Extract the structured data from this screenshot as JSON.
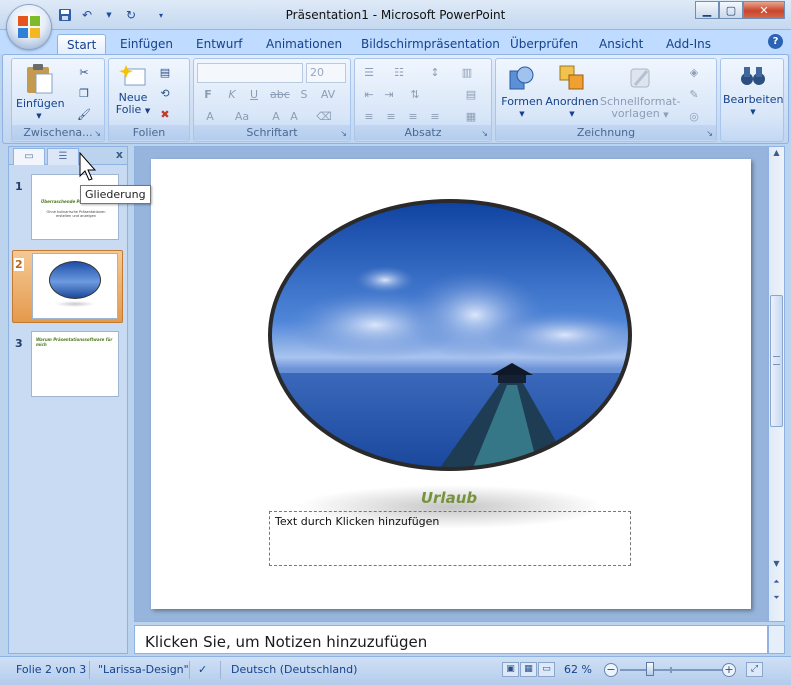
{
  "window": {
    "title": "Präsentation1 - Microsoft PowerPoint"
  },
  "tabs": [
    {
      "label": "Start",
      "active": true
    },
    {
      "label": "Einfügen"
    },
    {
      "label": "Entwurf"
    },
    {
      "label": "Animationen"
    },
    {
      "label": "Bildschirmpräsentation"
    },
    {
      "label": "Überprüfen"
    },
    {
      "label": "Ansicht"
    },
    {
      "label": "Add-Ins"
    }
  ],
  "ribbon": {
    "groups": {
      "clipboard": "Zwischena...",
      "slides": "Folien",
      "font": "Schriftart",
      "paragraph": "Absatz",
      "drawing": "Zeichnung",
      "editing": ""
    },
    "buttons": {
      "paste": "Einfügen",
      "new_slide_1": "Neue",
      "new_slide_2": "Folie",
      "shapes": "Formen",
      "arrange": "Anordnen",
      "quickstyles_1": "Schnellformat-",
      "quickstyles_2": "vorlagen",
      "edit": "Bearbeiten"
    },
    "font_size": "20"
  },
  "left_pane": {
    "tooltip": "Gliederung",
    "close": "x",
    "slides": [
      {
        "number": "1",
        "title": "Überraschende Präsentationen",
        "subtitle": "Ohne kulinarische Präsentationen erstellen und anzeigen"
      },
      {
        "number": "2"
      },
      {
        "number": "3",
        "title": "Warum Präsentationssoftware für mich"
      }
    ]
  },
  "slide": {
    "title": "Urlaub",
    "placeholder": "Text durch Klicken hinzufügen"
  },
  "notes": {
    "placeholder": "Klicken Sie, um Notizen hinzuzufügen"
  },
  "status": {
    "slide": "Folie 2 von 3",
    "theme": "\"Larissa-Design\"",
    "language": "Deutsch (Deutschland)",
    "zoom": "62 %"
  },
  "colors": {
    "accent": "#15428b",
    "slide_title": "#76923c",
    "selection": "#e49a4d"
  }
}
